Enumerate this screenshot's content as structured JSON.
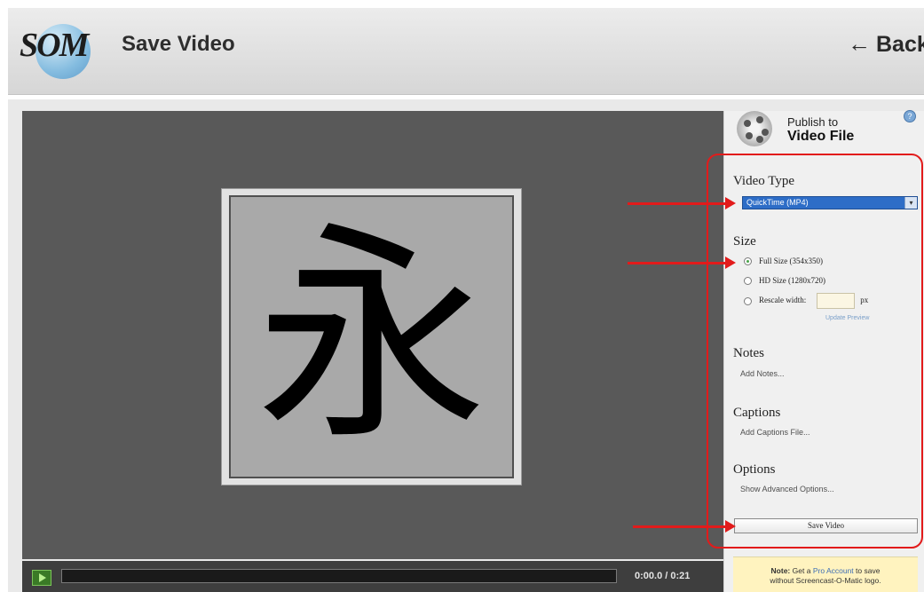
{
  "header": {
    "logo_text": "SOM",
    "title": "Save Video",
    "back_label": "Back",
    "back_arrow": "←"
  },
  "video": {
    "glyph": "永",
    "time_display": "0:00.0 / 0:21",
    "progress_fraction": 0.0
  },
  "panel": {
    "publish_line1": "Publish to",
    "publish_line2": "Video File",
    "help_glyph": "?",
    "video_type": {
      "heading": "Video Type",
      "selected": "QuickTime (MP4)"
    },
    "size": {
      "heading": "Size",
      "options": [
        {
          "label": "Full Size (354x350)",
          "selected": true
        },
        {
          "label": "HD Size (1280x720)",
          "selected": false
        },
        {
          "label": "Rescale width:",
          "selected": false
        }
      ],
      "unit": "px",
      "update_link": "Update Preview"
    },
    "notes": {
      "heading": "Notes",
      "link": "Add Notes..."
    },
    "captions": {
      "heading": "Captions",
      "link": "Add Captions File..."
    },
    "options": {
      "heading": "Options",
      "link": "Show Advanced Options..."
    },
    "save_button": "Save Video",
    "note": {
      "label": "Note:",
      "text_before": "Get a",
      "pro_link": "Pro Account",
      "text_after": "to save",
      "line2": "without Screencast-O-Matic logo."
    }
  },
  "colors": {
    "annotation_red": "#e21b1b",
    "select_blue": "#2d6dc7",
    "video_bg": "#595959"
  }
}
